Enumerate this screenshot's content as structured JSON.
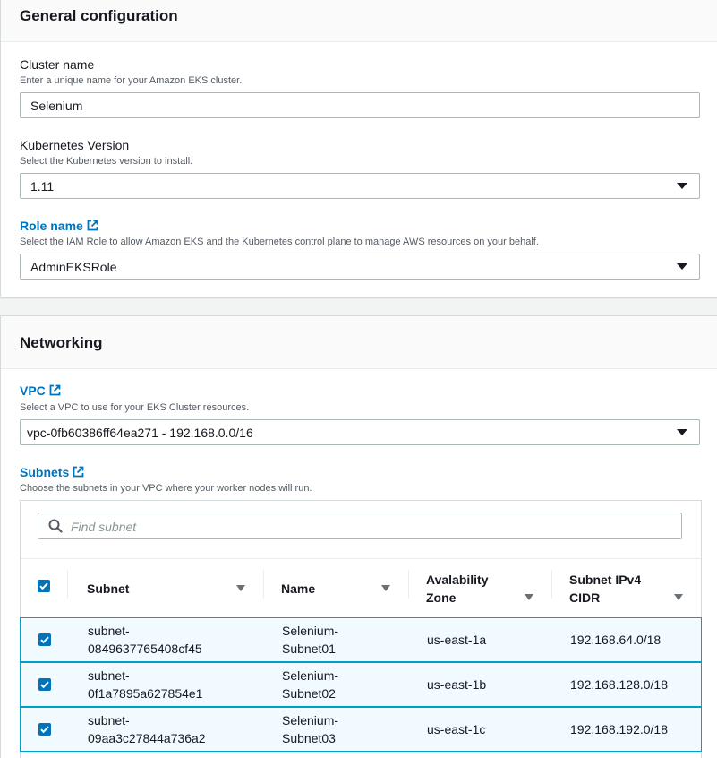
{
  "general": {
    "title": "General configuration",
    "cluster_name": {
      "label": "Cluster name",
      "description": "Enter a unique name for your Amazon EKS cluster.",
      "value": "Selenium"
    },
    "k8s_version": {
      "label": "Kubernetes Version",
      "description": "Select the Kubernetes version to install.",
      "value": "1.11"
    },
    "role": {
      "label": "Role name",
      "description": "Select the IAM Role to allow Amazon EKS and the Kubernetes control plane to manage AWS resources on your behalf.",
      "value": "AdminEKSRole"
    }
  },
  "networking": {
    "title": "Networking",
    "vpc": {
      "label": "VPC",
      "description": "Select a VPC to use for your EKS Cluster resources.",
      "value": "vpc-0fb60386ff64ea271 - 192.168.0.0/16"
    },
    "subnets": {
      "label": "Subnets",
      "description": "Choose the subnets in your VPC where your worker nodes will run.",
      "search_placeholder": "Find subnet",
      "columns": {
        "subnet": "Subnet",
        "name": "Name",
        "az_line1": "Avalability",
        "az_line2": "Zone",
        "cidr_line1": "Subnet IPv4",
        "cidr_line2": "CIDR"
      },
      "rows": [
        {
          "subnet_line1": "subnet-",
          "subnet_line2": "0849637765408cf45",
          "name_line1": "Selenium-",
          "name_line2": "Subnet01",
          "az": "us-east-1a",
          "cidr": "192.168.64.0/18",
          "checked": true
        },
        {
          "subnet_line1": "subnet-",
          "subnet_line2": "0f1a7895a627854e1",
          "name_line1": "Selenium-",
          "name_line2": "Subnet02",
          "az": "us-east-1b",
          "cidr": "192.168.128.0/18",
          "checked": true
        },
        {
          "subnet_line1": "subnet-",
          "subnet_line2": "09aa3c27844a736a2",
          "name_line1": "Selenium-",
          "name_line2": "Subnet03",
          "az": "us-east-1c",
          "cidr": "192.168.192.0/18",
          "checked": true
        }
      ]
    }
  },
  "colors": {
    "link": "#0073bb",
    "selected_row_bg": "#f1faff",
    "selected_row_border": "#00a1c9"
  }
}
